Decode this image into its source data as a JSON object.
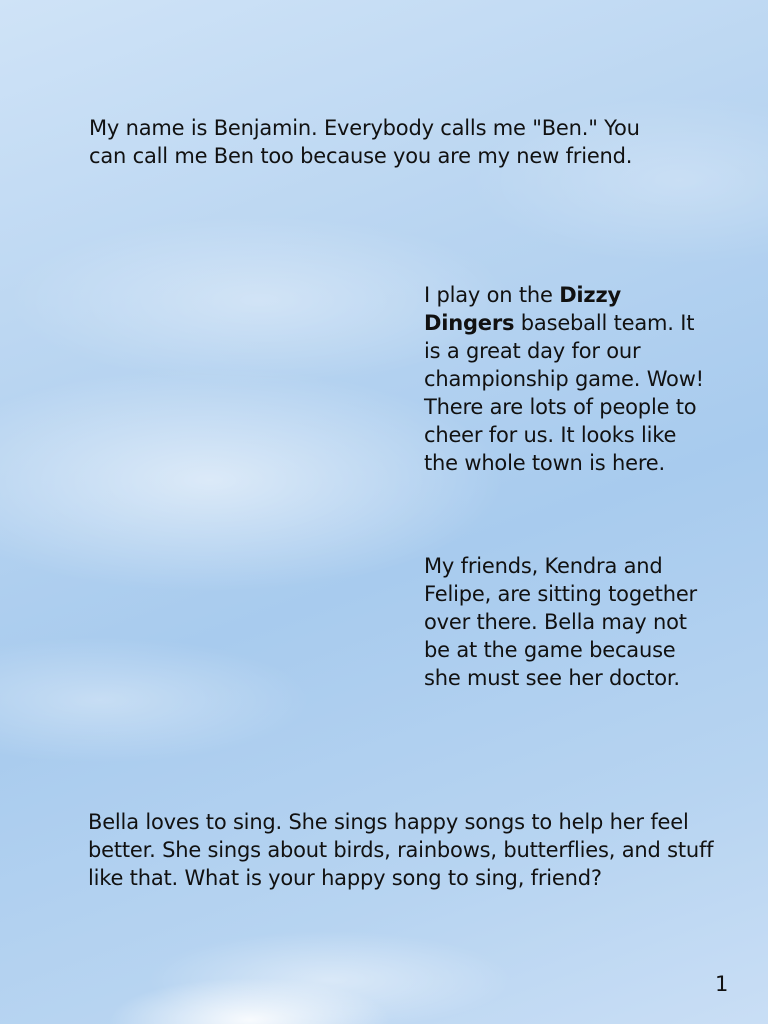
{
  "page": {
    "intro": "My name is Benjamin. Everybody calls me \"Ben.\" You can call me Ben too because you are my new friend.",
    "team": {
      "before": "I play on the ",
      "team_name": "Dizzy Dingers",
      "after": " baseball team. It is a great day for our championship game. Wow!  There are lots of people to cheer for us. It looks like the whole town is here."
    },
    "friends": "My friends, Kendra and Felipe, are sitting together over there. Bella may not be at the game because she must see her doctor.",
    "bella": "Bella loves to sing.  She sings happy songs to help her feel better.  She sings about birds, rainbows, butterflies, and stuff like that.  What is your happy song to sing, friend?",
    "page_number": "1"
  },
  "colors": {
    "text": "#111111",
    "sky_light": "#cfe3f7",
    "sky_mid": "#a8cbee"
  }
}
